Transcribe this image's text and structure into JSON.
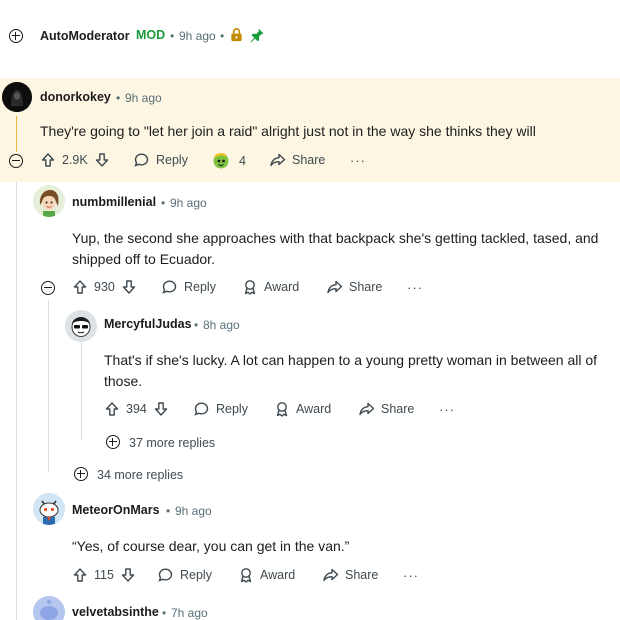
{
  "colors": {
    "mod_green": "#1a9b3a",
    "highlight_bg": "#fdf6e3",
    "thread_line": "#d8dcde",
    "meta_gray": "#576f76"
  },
  "automod": {
    "username": "AutoModerator",
    "mod_badge": "MOD",
    "sep": "•",
    "time": "9h ago",
    "sep2": "•",
    "icons": [
      "lock-icon",
      "pin-icon"
    ]
  },
  "comments": [
    {
      "username": "donorkokey",
      "sep": "•",
      "time": "9h ago",
      "text": "They're going to \"let her join a raid\" alright just not in the way she thinks they will",
      "votes": "2.9K",
      "reply_label": "Reply",
      "award_count": "4",
      "share_label": "Share",
      "more": "···"
    },
    {
      "username": "numbmillenial",
      "sep": "•",
      "time": "9h ago",
      "text": "Yup, the second she approaches with that backpack she's getting tackled, tased, and shipped off to Ecuador.",
      "votes": "930",
      "reply_label": "Reply",
      "award_label": "Award",
      "share_label": "Share",
      "more": "···"
    },
    {
      "username": "MercyfulJudas",
      "sep": "•",
      "time": "8h ago",
      "text": "That's if she's lucky. A lot can happen to a young pretty woman in between all of those.",
      "votes": "394",
      "reply_label": "Reply",
      "award_label": "Award",
      "share_label": "Share",
      "more": "···"
    },
    {
      "username": "MeteorOnMars",
      "sep": "•",
      "time": "9h ago",
      "text": "“Yes, of course dear, you can get in the van.”",
      "votes": "115",
      "reply_label": "Reply",
      "award_label": "Award",
      "share_label": "Share",
      "more": "···"
    },
    {
      "username": "velvetabsinthe",
      "sep": "•",
      "time": "7h ago"
    }
  ],
  "more_replies": [
    {
      "label": "37 more replies"
    },
    {
      "label": "34 more replies"
    }
  ]
}
